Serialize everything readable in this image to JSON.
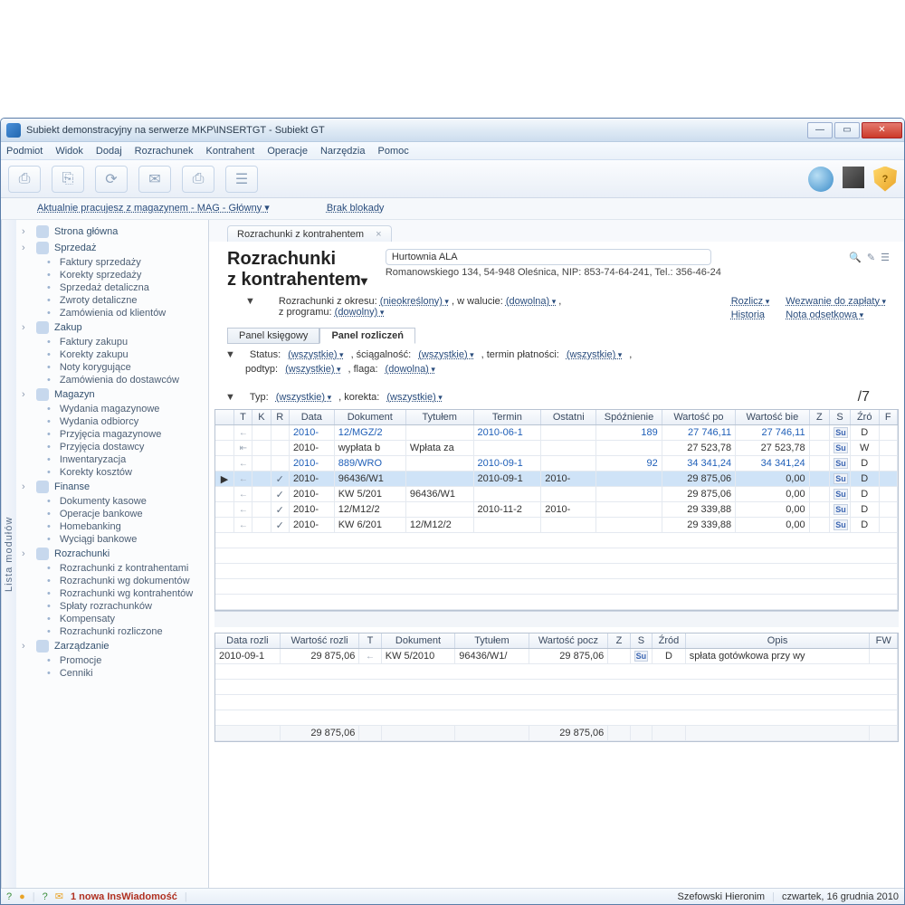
{
  "window": {
    "title": "Subiekt demonstracyjny na serwerze MKP\\INSERTGT - Subiekt GT"
  },
  "menu": [
    "Podmiot",
    "Widok",
    "Dodaj",
    "Rozrachunek",
    "Kontrahent",
    "Operacje",
    "Narzędzia",
    "Pomoc"
  ],
  "infobar": {
    "warehouse": "Aktualnie pracujesz z magazynem - MAG - Główny ▾",
    "lock": "Brak blokady"
  },
  "sidebar": {
    "title": "Lista modułów",
    "groups": [
      {
        "label": "Strona główna",
        "leaves": []
      },
      {
        "label": "Sprzedaż",
        "leaves": [
          "Faktury sprzedaży",
          "Korekty sprzedaży",
          "Sprzedaż detaliczna",
          "Zwroty detaliczne",
          "Zamówienia od klientów"
        ]
      },
      {
        "label": "Zakup",
        "leaves": [
          "Faktury zakupu",
          "Korekty zakupu",
          "Noty korygujące",
          "Zamówienia do dostawców"
        ]
      },
      {
        "label": "Magazyn",
        "leaves": [
          "Wydania magazynowe",
          "Wydania odbiorcy",
          "Przyjęcia magazynowe",
          "Przyjęcia dostawcy",
          "Inwentaryzacja",
          "Korekty kosztów"
        ]
      },
      {
        "label": "Finanse",
        "leaves": [
          "Dokumenty kasowe",
          "Operacje bankowe",
          "Homebanking",
          "Wyciągi bankowe"
        ]
      },
      {
        "label": "Rozrachunki",
        "leaves": [
          "Rozrachunki z kontrahentami",
          "Rozrachunki wg dokumentów",
          "Rozrachunki wg kontrahentów",
          "Spłaty rozrachunków",
          "Kompensaty",
          "Rozrachunki rozliczone"
        ]
      },
      {
        "label": "Zarządzanie",
        "leaves": [
          "Promocje",
          "Cenniki"
        ]
      }
    ]
  },
  "tab": {
    "title": "Rozrachunki z kontrahentem"
  },
  "header": {
    "h1_line1": "Rozrachunki",
    "h1_line2": "z kontrahentem",
    "party_name": "Hurtownia ALA",
    "party_addr": "Romanowskiego 134, 54-948 Oleśnica, NIP: 853-74-64-241, Tel.: 356-46-24"
  },
  "filters": {
    "l1_a": "Rozrachunki z okresu:",
    "l1_b": "(nieokreślony)",
    "l1_c": ", w walucie:",
    "l1_d": "(dowolna)",
    "l1_e": ",",
    "l2_a": "z programu:",
    "l2_b": "(dowolny)",
    "r": [
      "Rozlicz",
      "Wezwanie do zapłaty",
      "Historia",
      "Nota odsetkowa"
    ]
  },
  "subtabs": {
    "a": "Panel księgowy",
    "b": "Panel rozliczeń"
  },
  "row_status": {
    "a": "Status:",
    "a_v": "(wszystkie)",
    "b": ", ściągalność:",
    "b_v": "(wszystkie)",
    "c": ", termin płatności:",
    "c_v": "(wszystkie)",
    "d": ",",
    "e": "podtyp:",
    "e_v": "(wszystkie)",
    "f": ", flaga:",
    "f_v": "(dowolna)"
  },
  "row_type": {
    "a": "Typ:",
    "a_v": "(wszystkie)",
    "b": ", korekta:",
    "b_v": "(wszystkie)"
  },
  "count": "/7",
  "grid": {
    "cols": [
      "",
      "T",
      "K",
      "R",
      "Data",
      "Dokument",
      "Tytułem",
      "Termin",
      "Ostatni",
      "Spóźnienie",
      "Wartość po",
      "Wartość bie",
      "Z",
      "S",
      "Źró",
      "F"
    ],
    "rows": [
      {
        "t": "←",
        "r": "",
        "data": "2010-",
        "doc": "12/MGZ/2",
        "tyt": "",
        "term": "2010-06-1",
        "ost": "",
        "sp": "189",
        "wp": "27 746,11",
        "wb": "27 746,11",
        "s": "Su",
        "zr": "D",
        "blue": true
      },
      {
        "t": "⇤",
        "r": "",
        "data": "2010-",
        "doc": "wypłata b",
        "tyt": "Wpłata za",
        "term": "",
        "ost": "",
        "sp": "",
        "wp": "27 523,78",
        "wb": "27 523,78",
        "s": "Su",
        "zr": "W",
        "blue": false
      },
      {
        "t": "←",
        "r": "",
        "data": "2010-",
        "doc": "889/WRO",
        "tyt": "",
        "term": "2010-09-1",
        "ost": "",
        "sp": "92",
        "wp": "34 341,24",
        "wb": "34 341,24",
        "s": "Su",
        "zr": "D",
        "blue": true
      },
      {
        "mark": "▶",
        "t": "←",
        "r": "✓",
        "data": "2010-",
        "doc": "96436/W1",
        "tyt": "",
        "term": "2010-09-1",
        "ost": "2010-",
        "sp": "",
        "wp": "29 875,06",
        "wb": "0,00",
        "s": "Su",
        "zr": "D",
        "blue": false,
        "sel": true
      },
      {
        "t": "←",
        "r": "✓",
        "data": "2010-",
        "doc": "KW 5/201",
        "tyt": "96436/W1",
        "term": "",
        "ost": "",
        "sp": "",
        "wp": "29 875,06",
        "wb": "0,00",
        "s": "Su",
        "zr": "D",
        "blue": false
      },
      {
        "t": "←",
        "r": "✓",
        "data": "2010-",
        "doc": "12/M12/2",
        "tyt": "",
        "term": "2010-11-2",
        "ost": "2010-",
        "sp": "",
        "wp": "29 339,88",
        "wb": "0,00",
        "s": "Su",
        "zr": "D",
        "blue": false
      },
      {
        "t": "←",
        "r": "✓",
        "data": "2010-",
        "doc": "KW 6/201",
        "tyt": "12/M12/2",
        "term": "",
        "ost": "",
        "sp": "",
        "wp": "29 339,88",
        "wb": "0,00",
        "s": "Su",
        "zr": "D",
        "blue": false
      }
    ]
  },
  "grid2": {
    "cols": [
      "Data rozli",
      "Wartość rozli",
      "T",
      "Dokument",
      "Tytułem",
      "Wartość pocz",
      "Z",
      "S",
      "Źród",
      "Opis",
      "FW"
    ],
    "row": {
      "d": "2010-09-1",
      "w": "29 875,06",
      "t": "←",
      "doc": "KW 5/2010",
      "tyt": "96436/W1/",
      "wp": "29 875,06",
      "s": "Su",
      "zr": "D",
      "op": "spłata gotówkowa przy wy"
    },
    "sum": {
      "w": "29 875,06",
      "wp": "29 875,06"
    }
  },
  "status": {
    "msg": "1 nowa InsWiadomość",
    "user": "Szefowski Hieronim",
    "date": "czwartek, 16 grudnia 2010"
  }
}
